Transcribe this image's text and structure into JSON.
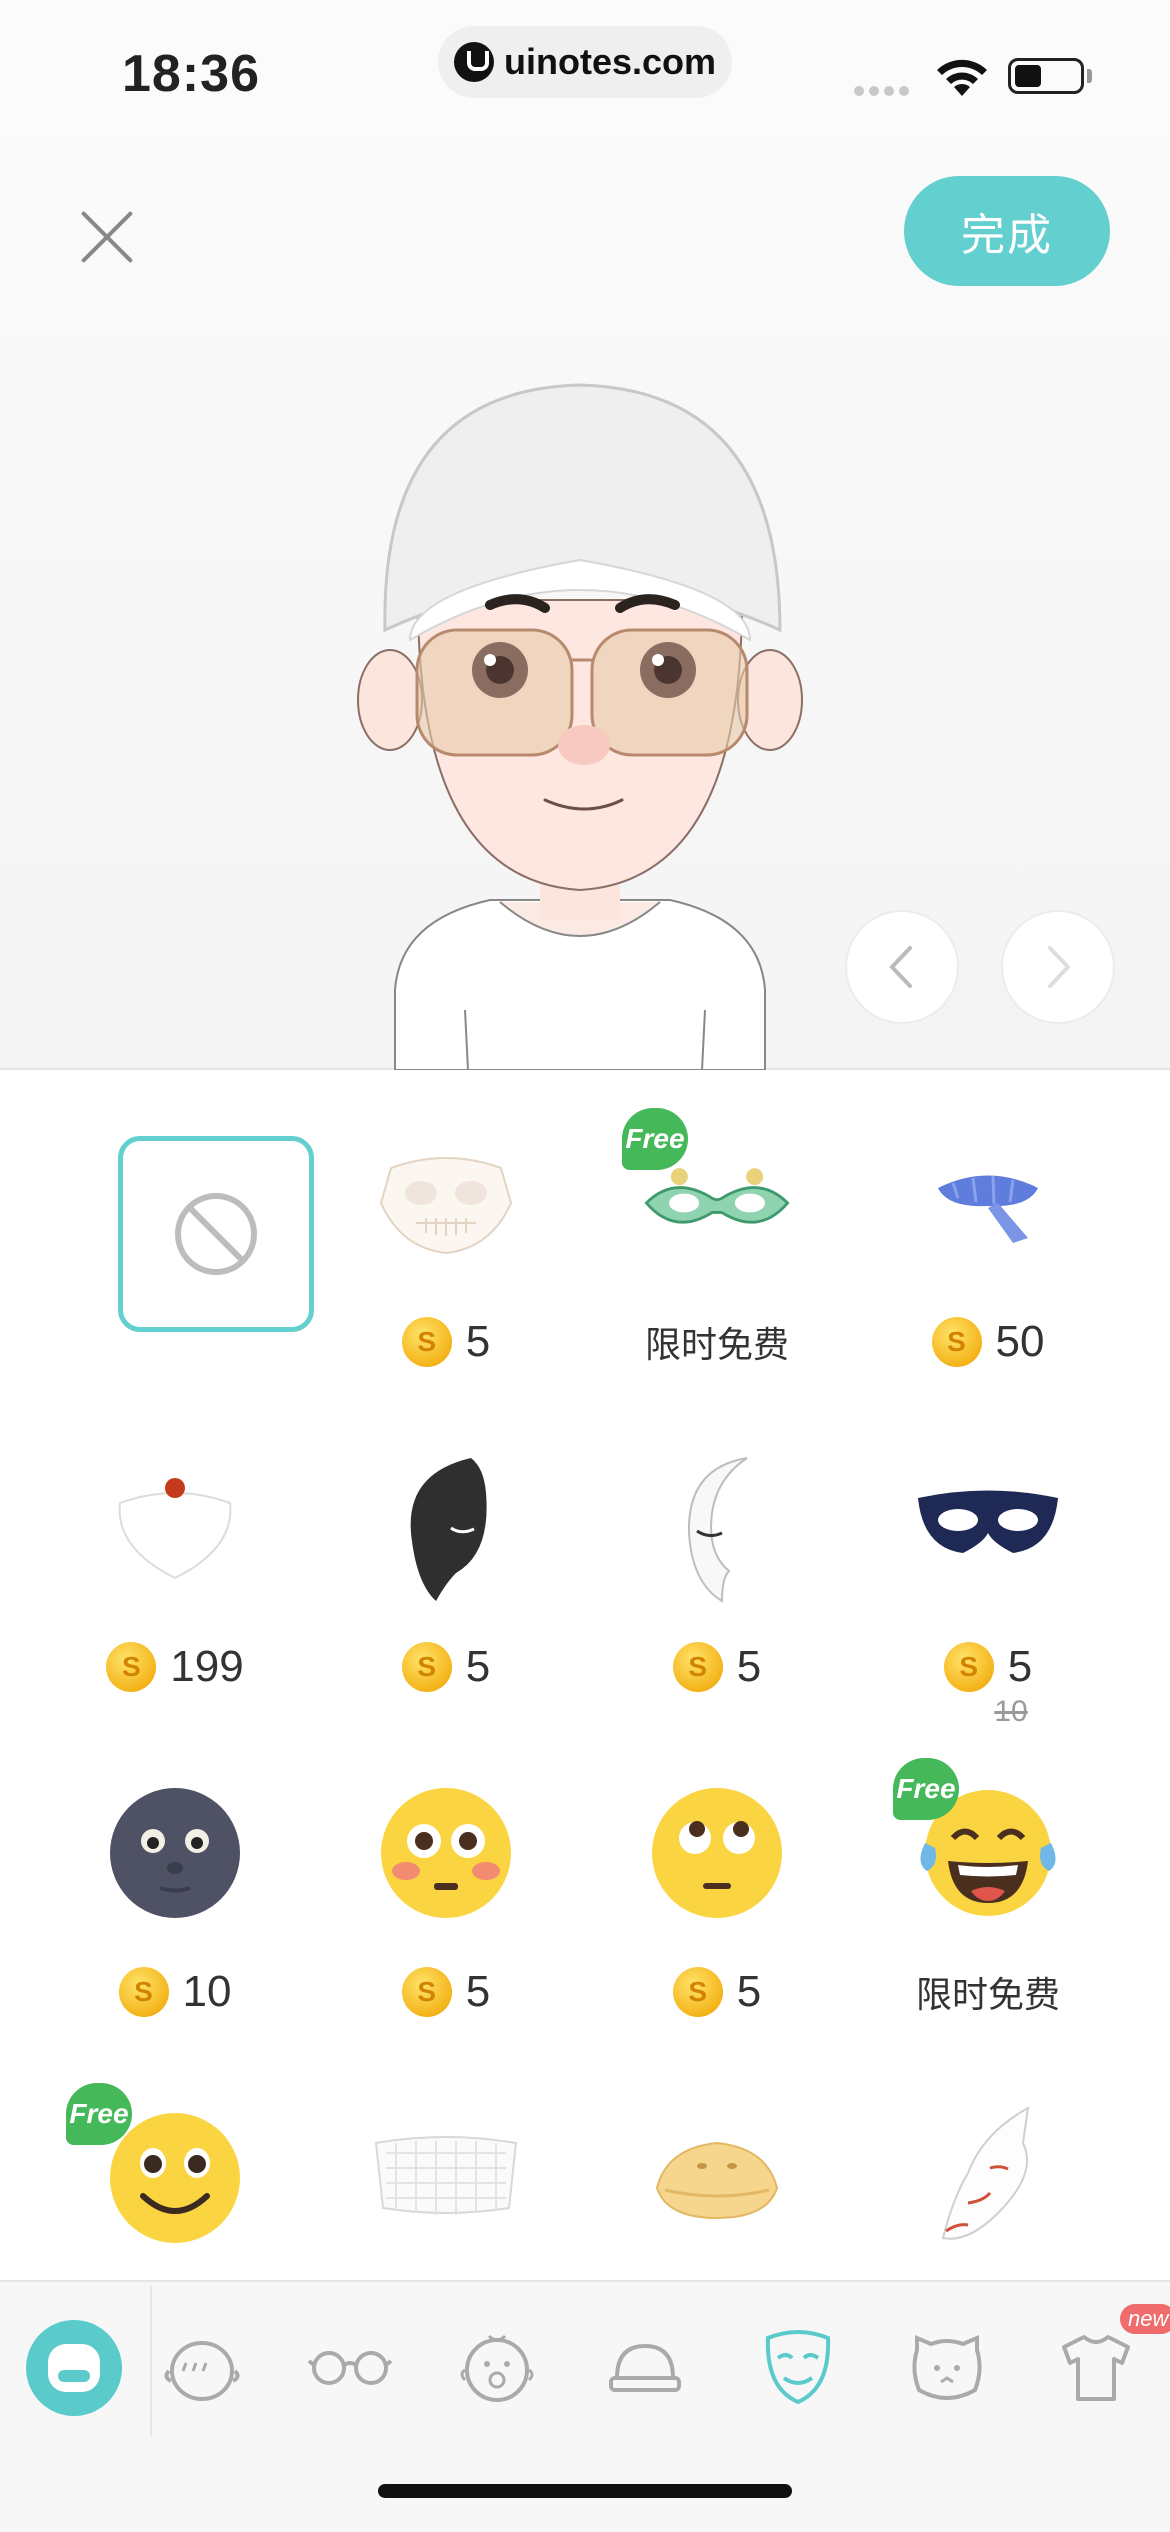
{
  "status_bar": {
    "time": "18:36",
    "url": "uinotes.com"
  },
  "header": {
    "done_label": "完成"
  },
  "items": [
    {
      "name": "none",
      "price": ""
    },
    {
      "name": "skull-mask",
      "price": "5",
      "coin": true
    },
    {
      "name": "lace-mask",
      "price": "限时免费",
      "free": true,
      "badge": "Free"
    },
    {
      "name": "scarf",
      "price": "50",
      "coin": true
    },
    {
      "name": "white-beard",
      "price": "199",
      "coin": true
    },
    {
      "name": "black-half-mask",
      "price": "5",
      "coin": true
    },
    {
      "name": "white-half-mask",
      "price": "5",
      "coin": true
    },
    {
      "name": "eye-mask",
      "price": "5",
      "coin": true,
      "old_price": "10"
    },
    {
      "name": "moon-face",
      "price": "10",
      "coin": true
    },
    {
      "name": "flushed-face",
      "price": "5",
      "coin": true
    },
    {
      "name": "eye-roll-face",
      "price": "5",
      "coin": true
    },
    {
      "name": "tears-of-joy-face",
      "price": "限时免费",
      "free": true,
      "badge": "Free"
    },
    {
      "name": "smiley-face",
      "badge": "Free"
    },
    {
      "name": "net-mask"
    },
    {
      "name": "duck-bill"
    },
    {
      "name": "fox-mask"
    }
  ],
  "coin_symbol": "S",
  "tabbar": {
    "new_badge": "new",
    "active": "mask"
  },
  "colors": {
    "accent": "#63cfcf",
    "free_green": "#45b85a",
    "coin": "#f4b41a",
    "new_red": "#f06b6b"
  }
}
